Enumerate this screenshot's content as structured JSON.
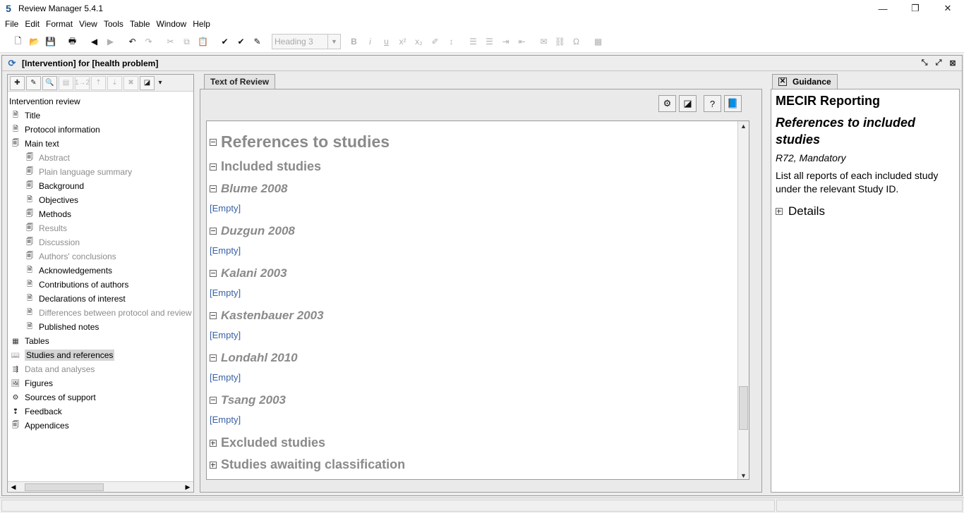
{
  "window": {
    "title": "Review Manager 5.4.1",
    "controls": [
      "—",
      "❐",
      "✕"
    ]
  },
  "menu": [
    {
      "label": "File"
    },
    {
      "label": "Edit"
    },
    {
      "label": "Format"
    },
    {
      "label": "View"
    },
    {
      "label": "Tools"
    },
    {
      "label": "Table"
    },
    {
      "label": "Window"
    },
    {
      "label": "Help"
    }
  ],
  "toolbar": {
    "style_select": "Heading 3",
    "buttons": [
      "new-icon",
      "open-icon",
      "save-icon",
      "print-icon",
      "back-icon",
      "forward-icon",
      "undo-icon",
      "redo-icon",
      "cut-icon",
      "copy-icon",
      "paste-icon",
      "spellcheck-icon",
      "abc-check-icon",
      "autocorrect-icon",
      "bold-icon",
      "italic-icon",
      "underline-icon",
      "superscript-icon",
      "subscript-icon",
      "highlight-icon",
      "align-icon",
      "bullet-list-icon",
      "numbered-list-icon",
      "indent-icon",
      "outdent-icon",
      "comment-icon",
      "link-icon",
      "symbol-icon",
      "table-icon"
    ]
  },
  "document": {
    "title": "[Intervention] for [health problem]"
  },
  "tree": {
    "root": "Intervention review",
    "items": [
      {
        "label": "Title",
        "level": 1,
        "gray": false
      },
      {
        "label": "Protocol information",
        "level": 1,
        "gray": false
      },
      {
        "label": "Main text",
        "level": 1,
        "gray": false
      },
      {
        "label": "Abstract",
        "level": 2,
        "gray": true
      },
      {
        "label": "Plain language summary",
        "level": 2,
        "gray": true
      },
      {
        "label": "Background",
        "level": 2,
        "gray": false
      },
      {
        "label": "Objectives",
        "level": 2,
        "gray": false
      },
      {
        "label": "Methods",
        "level": 2,
        "gray": false
      },
      {
        "label": "Results",
        "level": 2,
        "gray": true
      },
      {
        "label": "Discussion",
        "level": 2,
        "gray": true
      },
      {
        "label": "Authors' conclusions",
        "level": 2,
        "gray": true
      },
      {
        "label": "Acknowledgements",
        "level": 2,
        "gray": false
      },
      {
        "label": "Contributions of authors",
        "level": 2,
        "gray": false
      },
      {
        "label": "Declarations of interest",
        "level": 2,
        "gray": false
      },
      {
        "label": "Differences between protocol and review",
        "level": 2,
        "gray": true
      },
      {
        "label": "Published notes",
        "level": 2,
        "gray": false
      },
      {
        "label": "Tables",
        "level": 1,
        "gray": false
      },
      {
        "label": "Studies and references",
        "level": 1,
        "gray": false,
        "selected": true
      },
      {
        "label": "Data and analyses",
        "level": 1,
        "gray": true
      },
      {
        "label": "Figures",
        "level": 1,
        "gray": false
      },
      {
        "label": "Sources of support",
        "level": 1,
        "gray": false
      },
      {
        "label": "Feedback",
        "level": 1,
        "gray": false
      },
      {
        "label": "Appendices",
        "level": 1,
        "gray": false
      }
    ]
  },
  "center": {
    "tab": "Text of Review",
    "heading": "References to studies",
    "included": "Included studies",
    "studies": [
      {
        "name": "Blume 2008",
        "content": "[Empty]"
      },
      {
        "name": "Duzgun 2008",
        "content": "[Empty]"
      },
      {
        "name": "Kalani 2003",
        "content": "[Empty]"
      },
      {
        "name": "Kastenbauer 2003",
        "content": "[Empty]"
      },
      {
        "name": "Londahl 2010",
        "content": "[Empty]"
      },
      {
        "name": "Tsang 2003",
        "content": "[Empty]"
      }
    ],
    "excluded": "Excluded studies",
    "awaiting": "Studies awaiting classification"
  },
  "guidance": {
    "tab": "Guidance",
    "heading": "MECIR Reporting",
    "subheading": "References to included studies",
    "code": "R72, Mandatory",
    "text": "List all reports of each included study under the relevant Study ID.",
    "details": "Details"
  }
}
